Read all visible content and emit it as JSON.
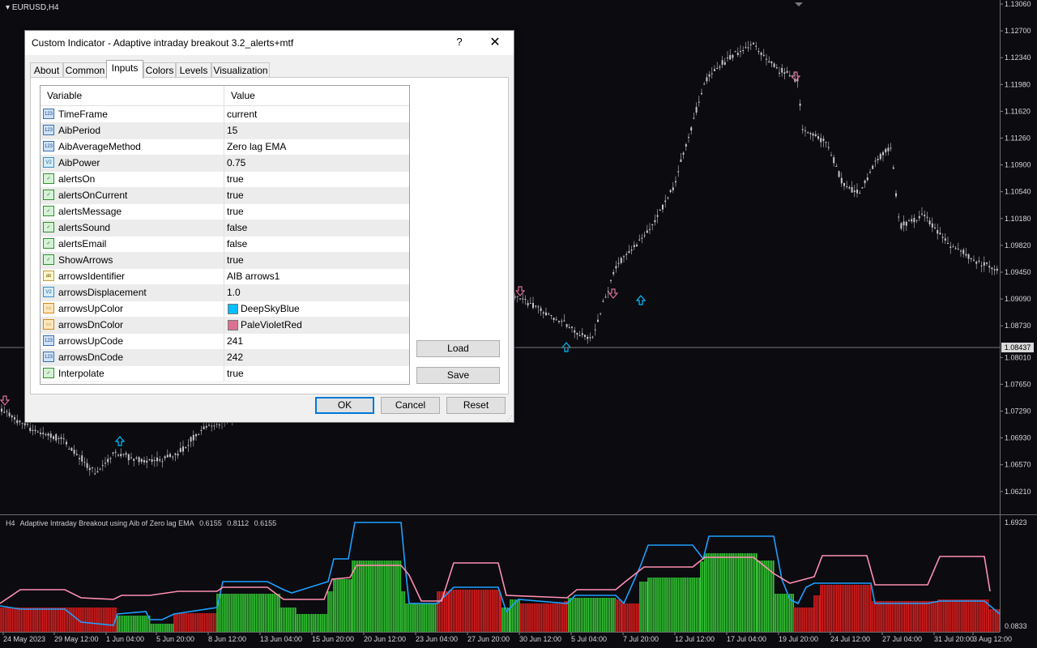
{
  "chart": {
    "symbol_label": "EURUSD,H4",
    "current_price": "1.08437",
    "price_axis": [
      "1.13060",
      "1.12700",
      "1.12340",
      "1.11980",
      "1.11620",
      "1.11260",
      "1.10900",
      "1.10540",
      "1.10180",
      "1.09820",
      "1.09450",
      "1.09090",
      "1.08730",
      "1.08010",
      "1.07650",
      "1.07290",
      "1.06930",
      "1.06570",
      "1.06210"
    ],
    "date_axis": [
      "24 May 2023",
      "29 May 12:00",
      "1 Jun 04:00",
      "5 Jun 20:00",
      "8 Jun 12:00",
      "13 Jun 04:00",
      "15 Jun 20:00",
      "20 Jun 12:00",
      "23 Jun 04:00",
      "27 Jun 20:00",
      "30 Jun 12:00",
      "5 Jul 04:00",
      "7 Jul 20:00",
      "12 Jul 12:00",
      "17 Jul 04:00",
      "19 Jul 20:00",
      "24 Jul 12:00",
      "27 Jul 04:00",
      "31 Jul 20:00",
      "3 Aug 12:00"
    ],
    "colors": {
      "background": "#0b0b10",
      "candle": "#c8c8c8",
      "up_arrow": "#00bfff",
      "down_arrow": "#db7093"
    }
  },
  "subwindow": {
    "header_tf": "H4",
    "header_name": "Adaptive Intraday Breakout using Aib of Zero lag EMA",
    "header_values": [
      "0.6155",
      "0.8112",
      "0.6155"
    ],
    "axis_top": "1.6923",
    "axis_bottom": "0.0833",
    "colors": {
      "green": "#32c832",
      "red": "#e01c1c",
      "blue_line": "#1ea0ff",
      "pink_line": "#ff8fb0"
    }
  },
  "dialog": {
    "title": "Custom Indicator - Adaptive intraday breakout 3.2_alerts+mtf",
    "help_label": "?",
    "close_label": "✕",
    "tabs": [
      {
        "label": "About"
      },
      {
        "label": "Common"
      },
      {
        "label": "Inputs",
        "active": true
      },
      {
        "label": "Colors"
      },
      {
        "label": "Levels"
      },
      {
        "label": "Visualization"
      }
    ],
    "grid_headers": {
      "variable": "Variable",
      "value": "Value"
    },
    "rows": [
      {
        "icon": "123",
        "name": "TimeFrame",
        "value": "current"
      },
      {
        "icon": "123",
        "name": "AibPeriod",
        "value": "15"
      },
      {
        "icon": "123",
        "name": "AibAverageMethod",
        "value": "Zero lag EMA"
      },
      {
        "icon": "V2",
        "name": "AibPower",
        "value": "0.75"
      },
      {
        "icon": "bool",
        "name": "alertsOn",
        "value": "true"
      },
      {
        "icon": "bool",
        "name": "alertsOnCurrent",
        "value": "true"
      },
      {
        "icon": "bool",
        "name": "alertsMessage",
        "value": "true"
      },
      {
        "icon": "bool",
        "name": "alertsSound",
        "value": "false"
      },
      {
        "icon": "bool",
        "name": "alertsEmail",
        "value": "false"
      },
      {
        "icon": "bool",
        "name": "ShowArrows",
        "value": "true"
      },
      {
        "icon": "ab",
        "name": "arrowsIdentifier",
        "value": "AIB arrows1"
      },
      {
        "icon": "V2",
        "name": "arrowsDisplacement",
        "value": "1.0"
      },
      {
        "icon": "color",
        "name": "arrowsUpColor",
        "value": "DeepSkyBlue",
        "swatch": "#00bfff"
      },
      {
        "icon": "color",
        "name": "arrowsDnColor",
        "value": "PaleVioletRed",
        "swatch": "#db7093"
      },
      {
        "icon": "123",
        "name": "arrowsUpCode",
        "value": "241"
      },
      {
        "icon": "123",
        "name": "arrowsDnCode",
        "value": "242"
      },
      {
        "icon": "bool",
        "name": "Interpolate",
        "value": "true"
      }
    ],
    "buttons": {
      "load": "Load",
      "save": "Save",
      "ok": "OK",
      "cancel": "Cancel",
      "reset": "Reset"
    }
  }
}
